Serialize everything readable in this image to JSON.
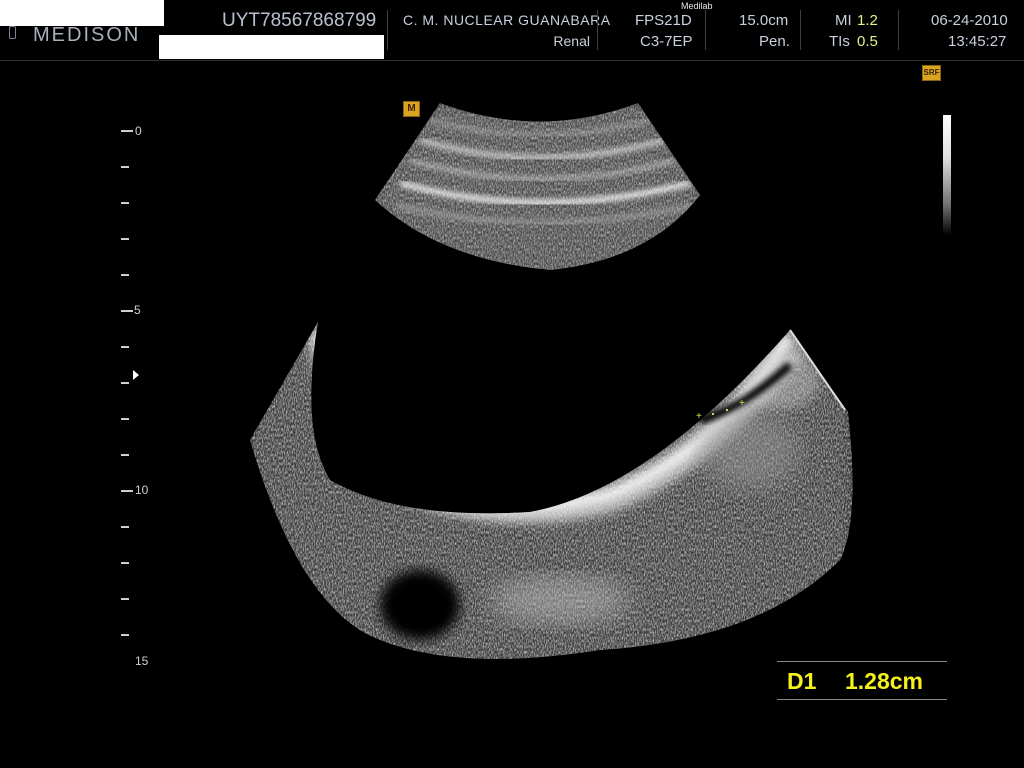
{
  "header": {
    "logo": "MEDISON",
    "patient_id": "UYT78567868799",
    "institution": "C. M. NUCLEAR  GUANABARA",
    "preset": "Renal",
    "probe_model": "FPS21D",
    "probe_freq": "C3-7EP",
    "overlay_label": "Medilab",
    "depth": "15.0cm",
    "harmonic": "Pen.",
    "mi_label": "MI",
    "mi_value": "1.2",
    "tis_label": "TIs",
    "tis_value": "0.5",
    "date": "06-24-2010",
    "time": "13:45:27"
  },
  "image": {
    "marker": "M",
    "srf_badge": "SRF",
    "depth_scale_labels": [
      "0",
      "5",
      "10",
      "15"
    ]
  },
  "measurement": {
    "label": "D1",
    "value": "1.28cm"
  },
  "colors": {
    "measurement_text": "#f4f21a",
    "header_text": "#c9d0de",
    "badge": "#d9a521",
    "index_value": "#e8f08a"
  }
}
